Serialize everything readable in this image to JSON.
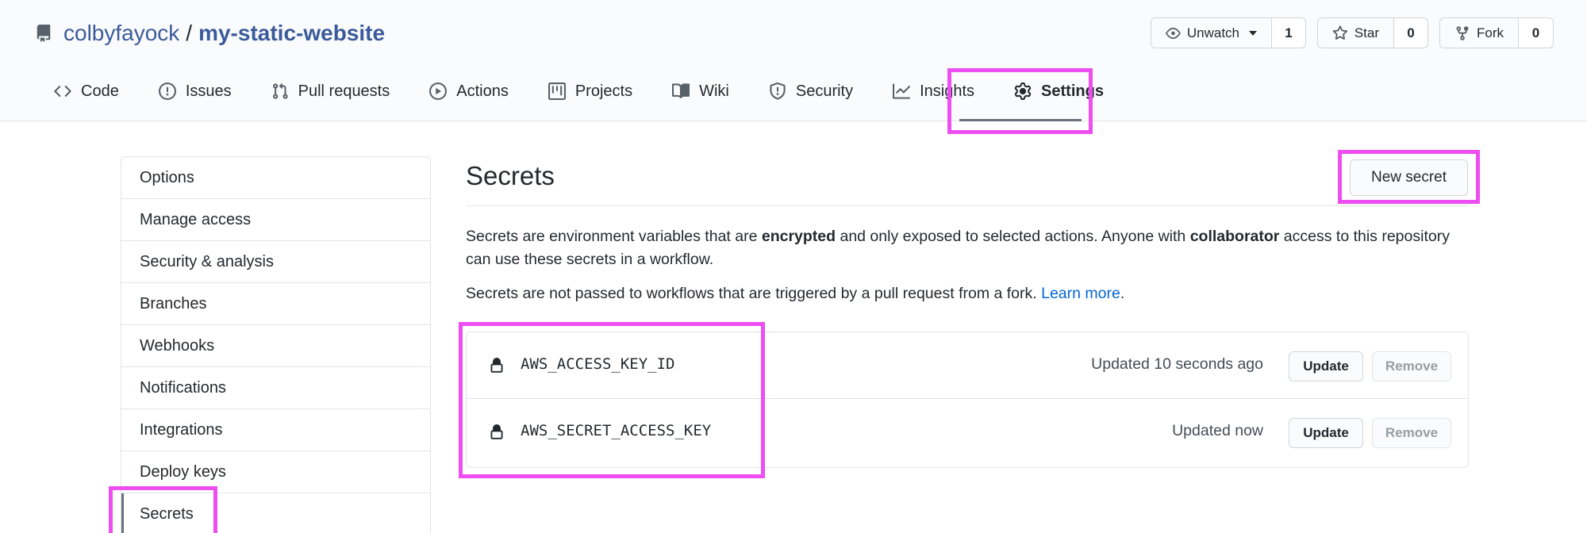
{
  "repo": {
    "owner": "colbyfayock",
    "separator": "/",
    "name": "my-static-website"
  },
  "actions": {
    "watch": {
      "label": "Unwatch",
      "count": "1"
    },
    "star": {
      "label": "Star",
      "count": "0"
    },
    "fork": {
      "label": "Fork",
      "count": "0"
    }
  },
  "tabs": [
    {
      "label": "Code",
      "icon": "code-icon"
    },
    {
      "label": "Issues",
      "icon": "issue-icon"
    },
    {
      "label": "Pull requests",
      "icon": "pull-request-icon"
    },
    {
      "label": "Actions",
      "icon": "play-icon"
    },
    {
      "label": "Projects",
      "icon": "project-icon"
    },
    {
      "label": "Wiki",
      "icon": "book-icon"
    },
    {
      "label": "Security",
      "icon": "shield-icon"
    },
    {
      "label": "Insights",
      "icon": "graph-icon"
    },
    {
      "label": "Settings",
      "icon": "gear-icon",
      "selected": true
    }
  ],
  "sidebar": {
    "items": [
      {
        "label": "Options"
      },
      {
        "label": "Manage access"
      },
      {
        "label": "Security & analysis"
      },
      {
        "label": "Branches"
      },
      {
        "label": "Webhooks"
      },
      {
        "label": "Notifications"
      },
      {
        "label": "Integrations"
      },
      {
        "label": "Deploy keys"
      },
      {
        "label": "Secrets",
        "selected": true
      }
    ]
  },
  "main": {
    "title": "Secrets",
    "new_secret_label": "New secret",
    "desc1": {
      "part1": "Secrets are environment variables that are ",
      "bold1": "encrypted",
      "part2": " and only exposed to selected actions. Anyone with ",
      "bold2": "collaborator",
      "part3": " access to this repository can use these secrets in a workflow."
    },
    "desc2": {
      "text": "Secrets are not passed to workflows that are triggered by a pull request from a fork. ",
      "link": "Learn more",
      "end": "."
    },
    "secrets": [
      {
        "name": "AWS_ACCESS_KEY_ID",
        "updated": "Updated 10 seconds ago",
        "update_label": "Update",
        "remove_label": "Remove"
      },
      {
        "name": "AWS_SECRET_ACCESS_KEY",
        "updated": "Updated now",
        "update_label": "Update",
        "remove_label": "Remove"
      }
    ]
  },
  "colors": {
    "highlight": "#ee4ef0",
    "link": "#0366d6",
    "repo_link": "#3a5a9b",
    "border": "#e1e4e8"
  }
}
